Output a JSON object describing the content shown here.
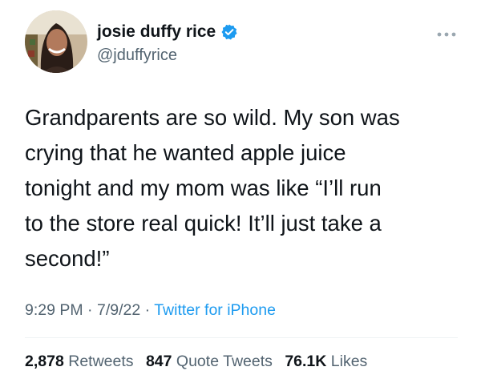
{
  "user": {
    "display_name": "josie duffy rice",
    "handle": "@jduffyrice",
    "verified": true,
    "avatar": "profile-photo"
  },
  "tweet": {
    "lines": [
      "Grandparents are so wild. My son was",
      "crying that he wanted apple juice",
      "tonight and my mom was like “I’ll run",
      "to the store real quick! It’ll just take a",
      "second!”"
    ],
    "time": "9:29 PM",
    "date": "7/9/22",
    "separator": "·",
    "source": "Twitter for iPhone"
  },
  "stats": {
    "retweets_count": "2,878",
    "retweets_label": "Retweets",
    "quotes_count": "847",
    "quotes_label": "Quote Tweets",
    "likes_count": "76.1K",
    "likes_label": "Likes"
  },
  "colors": {
    "text": "#0f1419",
    "secondary": "#536471",
    "accent": "#1d9bf0",
    "divider": "#eff3f4"
  },
  "icons": [
    "verified-badge-icon",
    "more-options-icon"
  ]
}
